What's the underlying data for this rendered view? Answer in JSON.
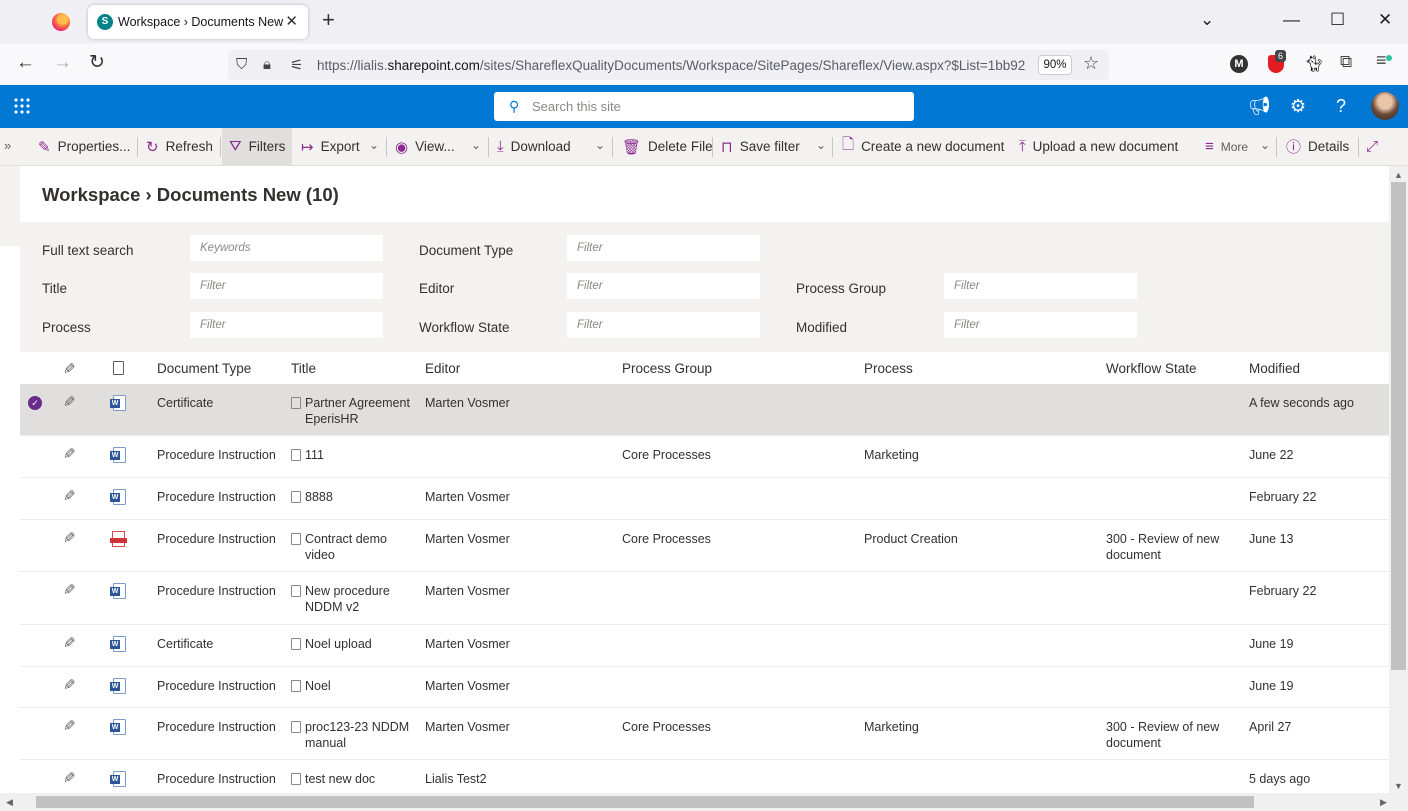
{
  "browser": {
    "tab_title": "Workspace › Documents New",
    "tab_close": "✕",
    "new_tab": "+",
    "url_prefix": "https://lialis.",
    "url_domain": "sharepoint.com",
    "url_path": "/sites/ShareflexQualityDocuments/Workspace/SitePages/Shareflex/View.aspx?$List=1bb92",
    "zoom": "90%",
    "extension_badge": "6",
    "extension_m": "M"
  },
  "suite": {
    "search_placeholder": "Search this site"
  },
  "command_bar": {
    "properties": "Properties...",
    "refresh": "Refresh",
    "filters": "Filters",
    "export": "Export",
    "view": "View...",
    "download": "Download",
    "delete_file": "Delete File",
    "save_filter": "Save filter",
    "create_document": "Create a new document",
    "upload_document": "Upload a new document",
    "more": "More",
    "details": "Details"
  },
  "page": {
    "title": "Workspace › Documents New (10)"
  },
  "filters": {
    "full_text_search": "Full text search",
    "keywords_placeholder": "Keywords",
    "document_type": "Document Type",
    "title": "Title",
    "editor": "Editor",
    "process_group": "Process Group",
    "process": "Process",
    "workflow_state": "Workflow State",
    "modified": "Modified",
    "filter_placeholder": "Filter"
  },
  "table": {
    "columns": {
      "document_type": "Document Type",
      "title": "Title",
      "editor": "Editor",
      "process_group": "Process Group",
      "process": "Process",
      "workflow_state": "Workflow State",
      "modified": "Modified"
    },
    "rows": [
      {
        "type": "Certificate",
        "title": "Partner Agreement EperisHR",
        "editor": "Marten Vosmer",
        "process_group": "",
        "process": "",
        "workflow": "",
        "modified": "A few seconds ago",
        "file": "word",
        "selected": true
      },
      {
        "type": "Procedure Instruction",
        "title": "111",
        "editor": "",
        "process_group": "Core Processes",
        "process": "Marketing",
        "workflow": "",
        "modified": "June 22",
        "file": "word"
      },
      {
        "type": "Procedure Instruction",
        "title": "8888",
        "editor": "Marten Vosmer",
        "process_group": "",
        "process": "",
        "workflow": "",
        "modified": "February 22",
        "file": "word"
      },
      {
        "type": "Procedure Instruction",
        "title": "Contract demo video",
        "editor": "Marten Vosmer",
        "process_group": "Core Processes",
        "process": "Product Creation",
        "workflow": "300 - Review of new document",
        "modified": "June 13",
        "file": "pdf"
      },
      {
        "type": "Procedure Instruction",
        "title": "New procedure NDDM v2",
        "editor": "Marten Vosmer",
        "process_group": "",
        "process": "",
        "workflow": "",
        "modified": "February 22",
        "file": "word"
      },
      {
        "type": "Certificate",
        "title": "Noel upload",
        "editor": "Marten Vosmer",
        "process_group": "",
        "process": "",
        "workflow": "",
        "modified": "June 19",
        "file": "word"
      },
      {
        "type": "Procedure Instruction",
        "title": "Noel",
        "editor": "Marten Vosmer",
        "process_group": "",
        "process": "",
        "workflow": "",
        "modified": "June 19",
        "file": "word"
      },
      {
        "type": "Procedure Instruction",
        "title": "proc123-23 NDDM manual",
        "editor": "Marten Vosmer",
        "process_group": "Core Processes",
        "process": "Marketing",
        "workflow": "300 - Review of new document",
        "modified": "April 27",
        "file": "word"
      },
      {
        "type": "Procedure Instruction",
        "title": "test new doc",
        "editor": "Lialis Test2",
        "process_group": "",
        "process": "",
        "workflow": "",
        "modified": "5 days ago",
        "file": "word"
      }
    ]
  }
}
